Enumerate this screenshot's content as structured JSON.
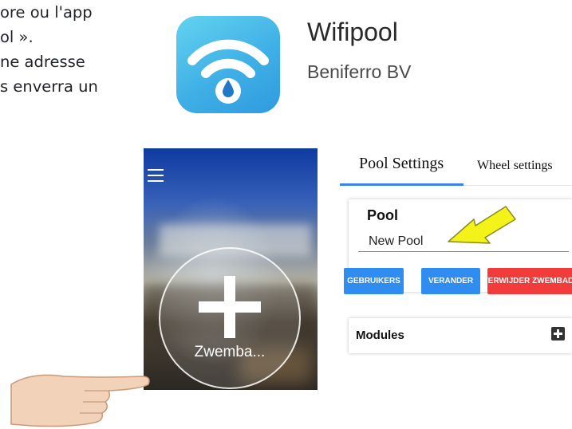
{
  "document": {
    "lines": [
      "ore ou l'app",
      "ol ».",
      "ne adresse",
      "s enverra un"
    ]
  },
  "app_listing": {
    "name": "Wifipool",
    "developer": "Beniferro BV",
    "icon": "wifi-drop-icon",
    "icon_color": "#3fb0e6"
  },
  "phone_screen": {
    "menu_icon": "hamburger-menu-icon",
    "add_button_label": "Zwemba..."
  },
  "pool_settings": {
    "tabs": [
      "Pool Settings",
      "Wheel settings"
    ],
    "active_tab_index": 0,
    "pool_section_title": "Pool",
    "pool_name_value": "New Pool",
    "buttons": {
      "users": "GEBRUIKERS",
      "change": "VERANDER",
      "delete": "VERWIJDER ZWEMBAD"
    },
    "modules_title": "Modules",
    "accent_color": "#2f8cf0",
    "danger_color": "#f23b3b"
  }
}
